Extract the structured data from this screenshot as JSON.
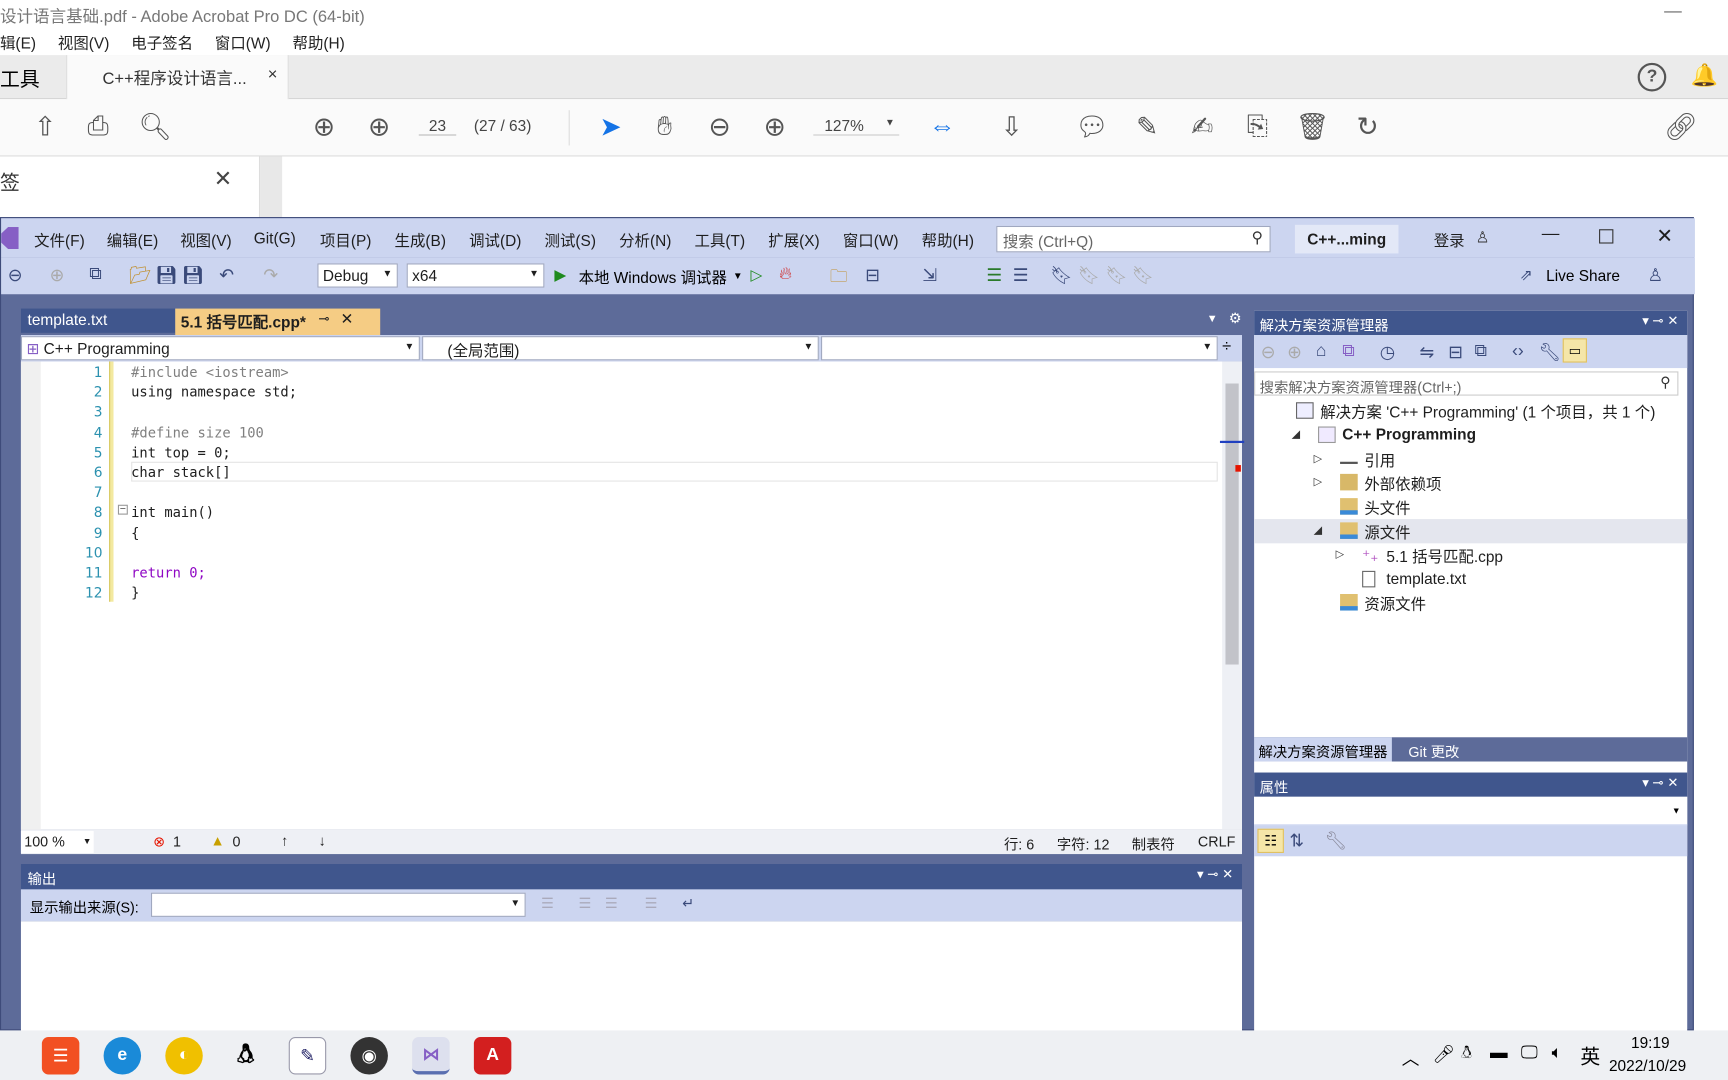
{
  "acrobat": {
    "title": "设计语言基础.pdf - Adobe Acrobat Pro DC (64-bit)",
    "menu": [
      "辑(E)",
      "视图(V)",
      "电子签名",
      "窗口(W)",
      "帮助(H)"
    ],
    "tools_tab": "工具",
    "doc_tab": "C++程序设计语言...",
    "page_input": "23",
    "page_count": "(27 / 63)",
    "zoom": "127%",
    "left_panel_title": "签"
  },
  "vs": {
    "menu": [
      "文件(F)",
      "编辑(E)",
      "视图(V)",
      "Git(G)",
      "项目(P)",
      "生成(B)",
      "调试(D)",
      "测试(S)",
      "分析(N)",
      "工具(T)",
      "扩展(X)",
      "窗口(W)",
      "帮助(H)"
    ],
    "search_placeholder": "搜索 (Ctrl+Q)",
    "solution_badge": "C++...ming",
    "login": "登录",
    "config": "Debug",
    "platform": "x64",
    "run_label": "本地 Windows 调试器",
    "live_share": "Live Share",
    "tabs": [
      {
        "label": "template.txt",
        "active": false
      },
      {
        "label": "5.1 括号匹配.cpp*",
        "active": true
      }
    ],
    "nav": {
      "project": "C++ Programming",
      "scope": "(全局范围)",
      "member": ""
    },
    "code": [
      {
        "n": "1",
        "text": "#include <iostream>"
      },
      {
        "n": "2",
        "text": "using namespace std;"
      },
      {
        "n": "3",
        "text": ""
      },
      {
        "n": "4",
        "text": "#define size 100"
      },
      {
        "n": "5",
        "text": "int top = 0;"
      },
      {
        "n": "6",
        "text": "char stack[]"
      },
      {
        "n": "7",
        "text": ""
      },
      {
        "n": "8",
        "text": "int main()"
      },
      {
        "n": "9",
        "text": "{"
      },
      {
        "n": "10",
        "text": ""
      },
      {
        "n": "11",
        "text": "    return 0;"
      },
      {
        "n": "12",
        "text": "}"
      }
    ],
    "status": {
      "zoom": "100 %",
      "errors": "1",
      "warnings": "0",
      "line": "行: 6",
      "char": "字符: 12",
      "indent": "制表符",
      "eol": "CRLF"
    },
    "output": {
      "title": "输出",
      "source_label": "显示输出来源(S):",
      "source_value": ""
    },
    "solution_explorer": {
      "title": "解决方案资源管理器",
      "search_placeholder": "搜索解决方案资源管理器(Ctrl+;)",
      "tree": [
        {
          "label": "解决方案 'C++ Programming' (1 个项目，共 1 个)",
          "depth": 0,
          "arrow": "",
          "icon": "solution-icon"
        },
        {
          "label": "C++ Programming",
          "depth": 1,
          "arrow": "expanded",
          "icon": "project-icon",
          "bold": true
        },
        {
          "label": "引用",
          "depth": 2,
          "arrow": "collapsed",
          "icon": "references-icon"
        },
        {
          "label": "外部依赖项",
          "depth": 2,
          "arrow": "collapsed",
          "icon": "external-deps-icon"
        },
        {
          "label": "头文件",
          "depth": 2,
          "arrow": "",
          "icon": "filter-folder-icon"
        },
        {
          "label": "源文件",
          "depth": 2,
          "arrow": "expanded",
          "icon": "filter-folder-icon",
          "selected": true
        },
        {
          "label": "5.1 括号匹配.cpp",
          "depth": 3,
          "arrow": "collapsed",
          "icon": "cpp-file-icon"
        },
        {
          "label": "template.txt",
          "depth": 3,
          "arrow": "",
          "icon": "text-file-icon"
        },
        {
          "label": "资源文件",
          "depth": 2,
          "arrow": "",
          "icon": "filter-folder-icon"
        }
      ],
      "bottom_tabs": [
        "解决方案资源管理器",
        "Git 更改"
      ]
    },
    "properties": {
      "title": "属性"
    }
  },
  "taskbar": {
    "ime": "英",
    "time": "19:19",
    "date": "2022/10/29"
  },
  "colors": {
    "vs_accent": "#40568d",
    "vs_chrome": "#ccd5f0",
    "tab_active": "#f5cc84",
    "error": "#e51400",
    "run_green": "#1e8a1e"
  }
}
